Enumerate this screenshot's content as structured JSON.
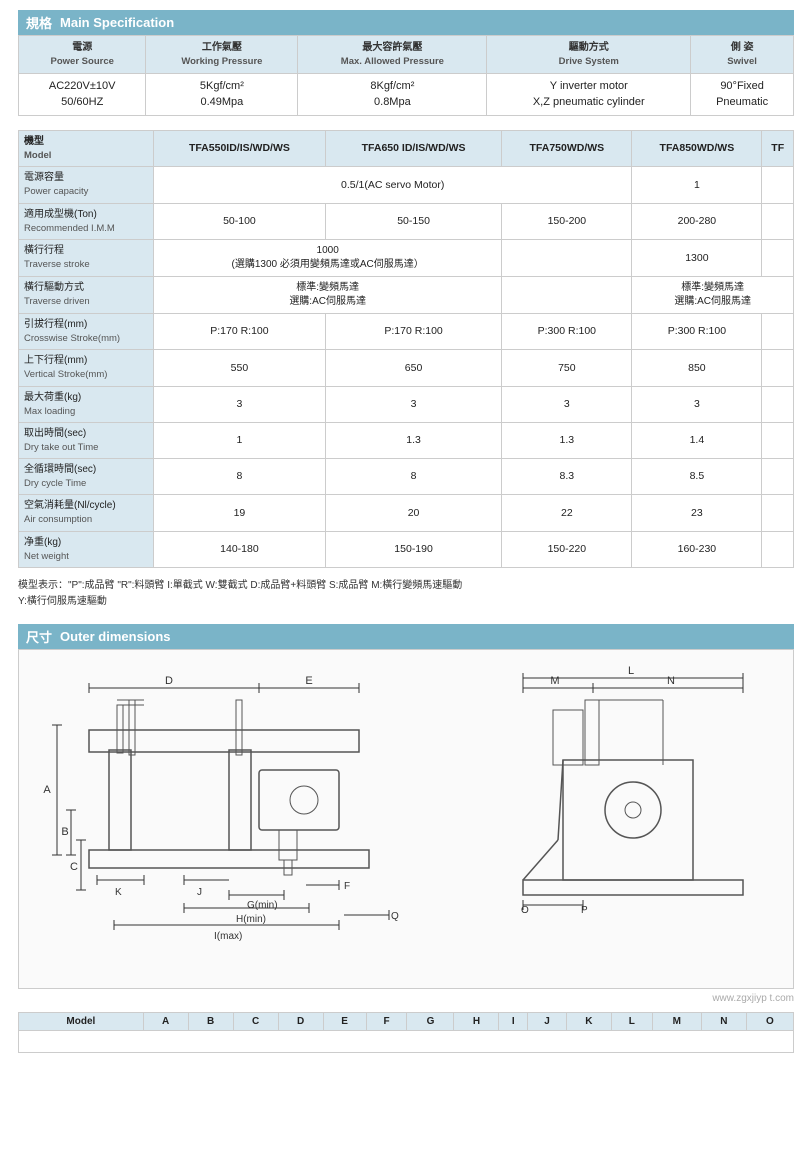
{
  "sections": {
    "main_spec": {
      "label_zh": "規格",
      "label_en": "Main Specification"
    },
    "outer_dim": {
      "label_zh": "尺寸",
      "label_en": "Outer dimensions"
    }
  },
  "top_table": {
    "headers": [
      {
        "zh": "電源",
        "en": "Power Source"
      },
      {
        "zh": "工作氣壓",
        "en": "Working Pressure"
      },
      {
        "zh": "最大容許氣壓",
        "en": "Max. Allowed Pressure"
      },
      {
        "zh": "驅動方式",
        "en": "Drive System"
      },
      {
        "zh": "側 姿",
        "en": "Swivel"
      }
    ],
    "rows": [
      [
        "AC220V±10V\n50/60HZ",
        "5Kgf/cm²\n0.49Mpa",
        "8Kgf/cm²\n0.8Mpa",
        "Y inverter motor\nX,Z pneumatic cylinder",
        "90°Fixed\nPneumatic"
      ]
    ]
  },
  "model_table": {
    "col_headers": [
      "TFA550ID/IS/WD/WS",
      "TFA650 ID/IS/WD/WS",
      "TFA750WD/WS",
      "TFA850WD/WS",
      "TF"
    ],
    "row_headers": [
      {
        "zh": "機型",
        "en": "Model"
      },
      {
        "zh": "電源容量",
        "en": "Power capacity"
      },
      {
        "zh": "適用成型機(Ton)",
        "en": "Recommended I.M.M"
      },
      {
        "zh": "橫行行程",
        "en": "Traverse stroke"
      },
      {
        "zh": "橫行驅動方式",
        "en": "Traverse driven"
      },
      {
        "zh": "引拔行程(mm)",
        "en": "Crosswise Stroke(mm)"
      },
      {
        "zh": "上下行程(mm)",
        "en": "Vertical Stroke(mm)"
      },
      {
        "zh": "最大荷重(kg)",
        "en": "Max loading"
      },
      {
        "zh": "取出時間(sec)",
        "en": "Dry take out Time"
      },
      {
        "zh": "全循環時間(sec)",
        "en": "Dry cycle Time"
      },
      {
        "zh": "空氣消耗量(Nl/cycle)",
        "en": "Air consumption"
      },
      {
        "zh": "净重(kg)",
        "en": "Net weight"
      }
    ],
    "rows": [
      [
        "0.5/1(AC servo Motor)",
        "",
        "",
        "1",
        ""
      ],
      [
        "50-100",
        "50-150",
        "150-200",
        "200-280",
        ""
      ],
      [
        "1000\n(選購1300 必須用變頻馬達或AC伺服馬達）",
        "",
        "",
        "1300",
        ""
      ],
      [
        "標準:變頻馬達\n選購:AC伺服馬達",
        "",
        "標準:變頻馬達\n選購:AC伺服馬達",
        "",
        ""
      ],
      [
        "P:170  R:100",
        "P:170  R:100",
        "P:300  R:100",
        "P:300  R:100",
        ""
      ],
      [
        "550",
        "650",
        "750",
        "850",
        ""
      ],
      [
        "3",
        "3",
        "3",
        "3",
        ""
      ],
      [
        "1",
        "1.3",
        "1.3",
        "1.4",
        ""
      ],
      [
        "8",
        "8",
        "8.3",
        "8.5",
        ""
      ],
      [
        "19",
        "20",
        "22",
        "23",
        ""
      ],
      [
        "140-180",
        "150-190",
        "150-220",
        "160-230",
        ""
      ]
    ]
  },
  "note": "模型表示：\"P\":成品臂 \"R\":料頭臂 I:單截式  W:雙截式 D:成品臂+料頭臂 S:成品臂  M:橫行變頻馬速驅動\nY:橫行伺服馬速驅動",
  "bottom_table": {
    "headers": [
      "Model",
      "A",
      "B",
      "C",
      "D",
      "E",
      "F",
      "G",
      "H",
      "I",
      "J",
      "K",
      "L",
      "M",
      "N",
      "O"
    ],
    "rows": []
  },
  "watermark": "www.zgxjiyp t.com",
  "diagram": {
    "labels_left": [
      "A",
      "B",
      "C",
      "D",
      "E",
      "F",
      "G(min)",
      "H(min)",
      "I(max)",
      "J",
      "K",
      "Q"
    ],
    "labels_right": [
      "L",
      "M",
      "N",
      "O",
      "P"
    ]
  }
}
